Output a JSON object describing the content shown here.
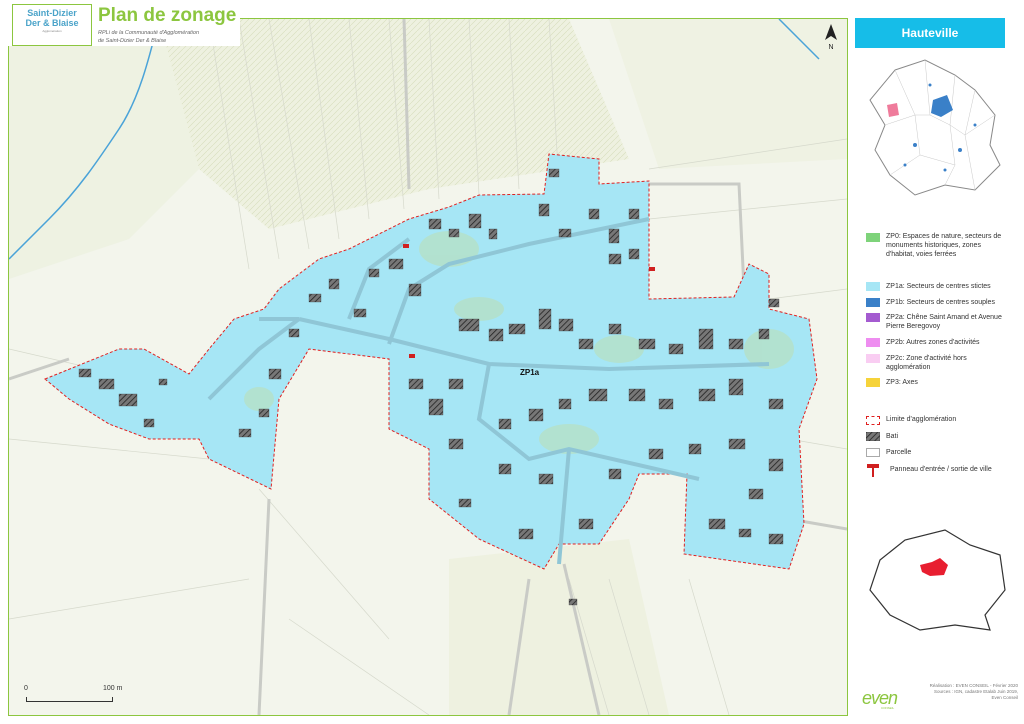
{
  "header": {
    "logo_line1": "Saint-Dizier",
    "logo_line2": "Der & Blaise",
    "logo_line3": "Agglomération",
    "title": "Plan de zonage",
    "subtitle_line1": "RPLi de la Communauté d'Agglomération",
    "subtitle_line2": "de Saint-Dizier Der & Blaise"
  },
  "commune": "Hauteville",
  "map": {
    "zone_label": "ZP1a",
    "north_label": "N",
    "scale_start": "0",
    "scale_end": "100 m"
  },
  "legend": {
    "zones": [
      {
        "label": "ZP0: Espaces de nature, secteurs de monuments historiques, zones d'habitat, voies ferrées",
        "color": "#7ed37a"
      },
      {
        "label": "ZP1a: Secteurs de centres stictes",
        "color": "#a6e6f5"
      },
      {
        "label": "ZP1b: Secteurs de centres souples",
        "color": "#3a80c8"
      },
      {
        "label": "ZP2a: Chêne Saint Amand et Avenue Pierre Beregovoy",
        "color": "#a45bd0"
      },
      {
        "label": "ZP2b: Autres zones d'activités",
        "color": "#ee8df0"
      },
      {
        "label": "ZP2c: Zone d'activité hors agglomération",
        "color": "#f9cdf2"
      },
      {
        "label": "ZP3: Axes",
        "color": "#f6d33a"
      }
    ],
    "symbols": [
      {
        "label": "Limite d'agglomération",
        "icon": "dashed-red-boundary"
      },
      {
        "label": "Bati",
        "icon": "hatched-building"
      },
      {
        "label": "Parcelle",
        "icon": "parcel-outline"
      },
      {
        "label": "Panneau d'entrée / sortie de ville",
        "icon": "entry-sign"
      }
    ]
  },
  "credits": {
    "line1": "Réalisation : EVEN CONSEIL - Février 2020",
    "line2": "Sources : IGN, cadastre Etalab Juin 2019,",
    "line3": "Even Conseil"
  },
  "brand": {
    "name": "even",
    "tag": "CONSEIL"
  },
  "colors": {
    "accent": "#8cc63f",
    "title_bar": "#16bde8",
    "zone_fill": "#a6e6f5",
    "boundary": "#e02020"
  }
}
